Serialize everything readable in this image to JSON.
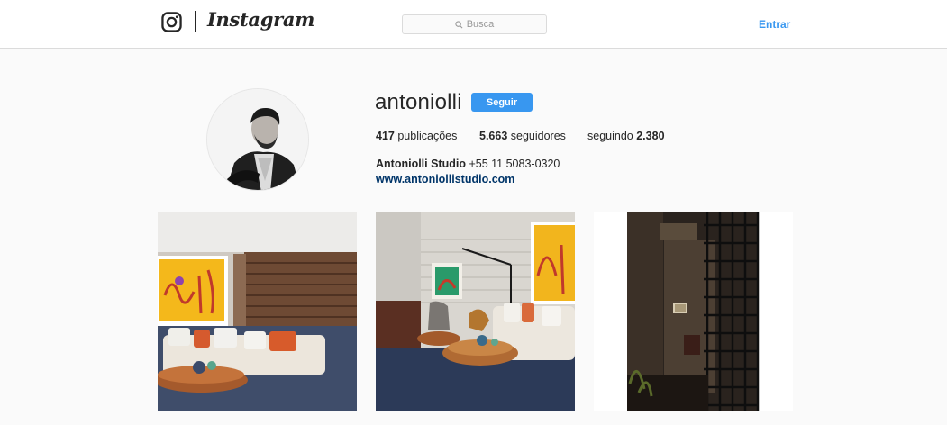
{
  "header": {
    "logo_icon": "instagram-camera-icon",
    "wordmark": "Instagram",
    "search_icon": "search-icon",
    "search_placeholder": "Busca",
    "login_label": "Entrar",
    "accent_color": "#3897f0"
  },
  "profile": {
    "avatar_icon": "profile-photo",
    "username": "antoniolli",
    "follow_label": "Seguir",
    "stats": {
      "posts_count": "417",
      "posts_label": "publicações",
      "followers_count": "5.663",
      "followers_label": "seguidores",
      "following_label": "seguindo",
      "following_count": "2.380"
    },
    "full_name": "Antoniolli Studio",
    "phone": "+55 11 5083-0320",
    "website": "www.antoniollistudio.com"
  },
  "posts": [
    {
      "image": "living-room-with-yellow-artwork-and-sofa"
    },
    {
      "image": "living-room-with-sofa-and-round-coffee-tables"
    },
    {
      "image": "dark-corridor-with-metal-lattice-screen"
    }
  ]
}
